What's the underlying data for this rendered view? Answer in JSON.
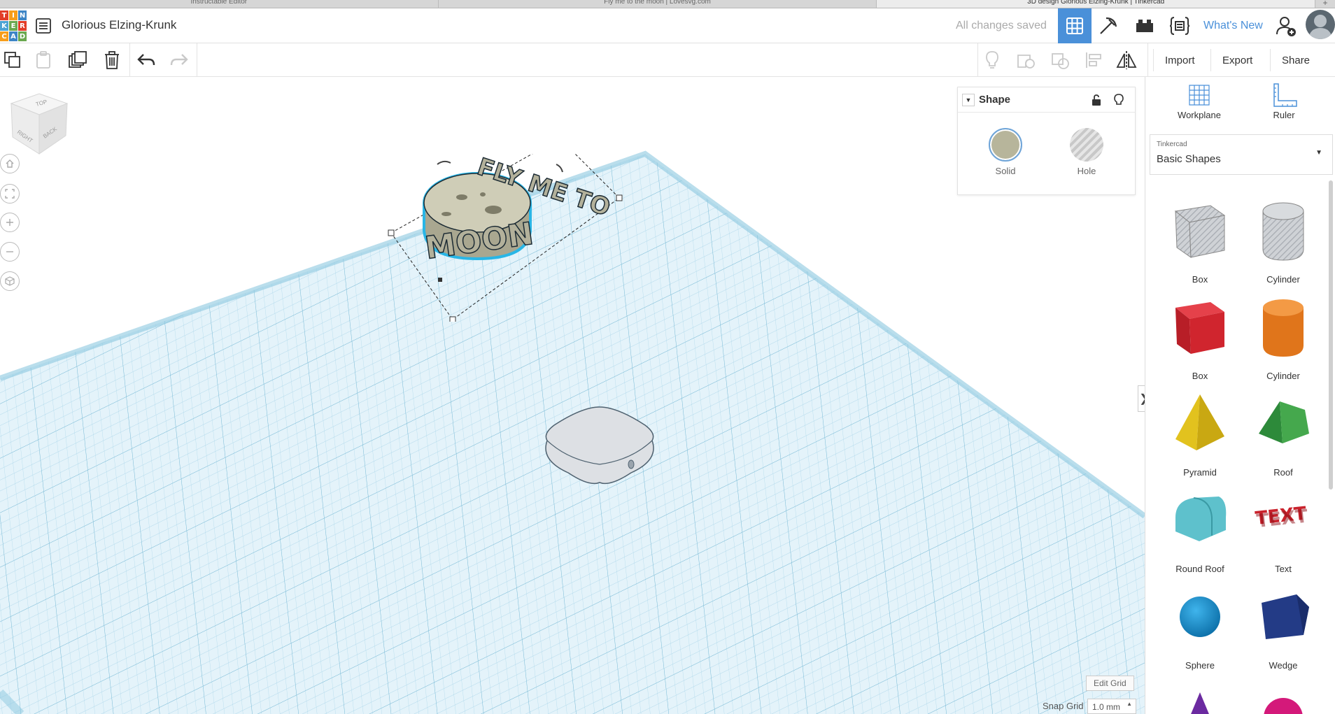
{
  "browser_tabs": [
    "Instructable Editor",
    "Fly me to the moon | Lovesvg.com",
    "3D design Glorious Elzing-Krunk | Tinkercad"
  ],
  "logo": {
    "letters": [
      "T",
      "I",
      "N",
      "K",
      "E",
      "R",
      "C",
      "A",
      "D"
    ]
  },
  "header": {
    "design_name": "Glorious Elzing-Krunk",
    "save_status": "All changes saved",
    "whats_new": "What's New"
  },
  "toolbar": {
    "import": "Import",
    "export": "Export",
    "share": "Share"
  },
  "viewcube": {
    "top": "TOP",
    "right": "RIGHT",
    "back": "BACK"
  },
  "inspector": {
    "title": "Shape",
    "solid": "Solid",
    "hole": "Hole",
    "solid_color": "#b7b59b"
  },
  "right_panel": {
    "workplane": "Workplane",
    "ruler": "Ruler",
    "library_source": "Tinkercad",
    "library_name": "Basic Shapes",
    "shapes": [
      "Box",
      "Cylinder",
      "Box",
      "Cylinder",
      "Pyramid",
      "Roof",
      "Round Roof",
      "Text",
      "Sphere",
      "Wedge"
    ]
  },
  "bottom": {
    "edit_grid": "Edit Grid",
    "snap_grid_label": "Snap Grid",
    "snap_grid_value": "1.0 mm"
  },
  "colors": {
    "accent": "#4a90d9",
    "grid_line": "#9fd0e6",
    "grid_bg": "#dff1f8"
  }
}
